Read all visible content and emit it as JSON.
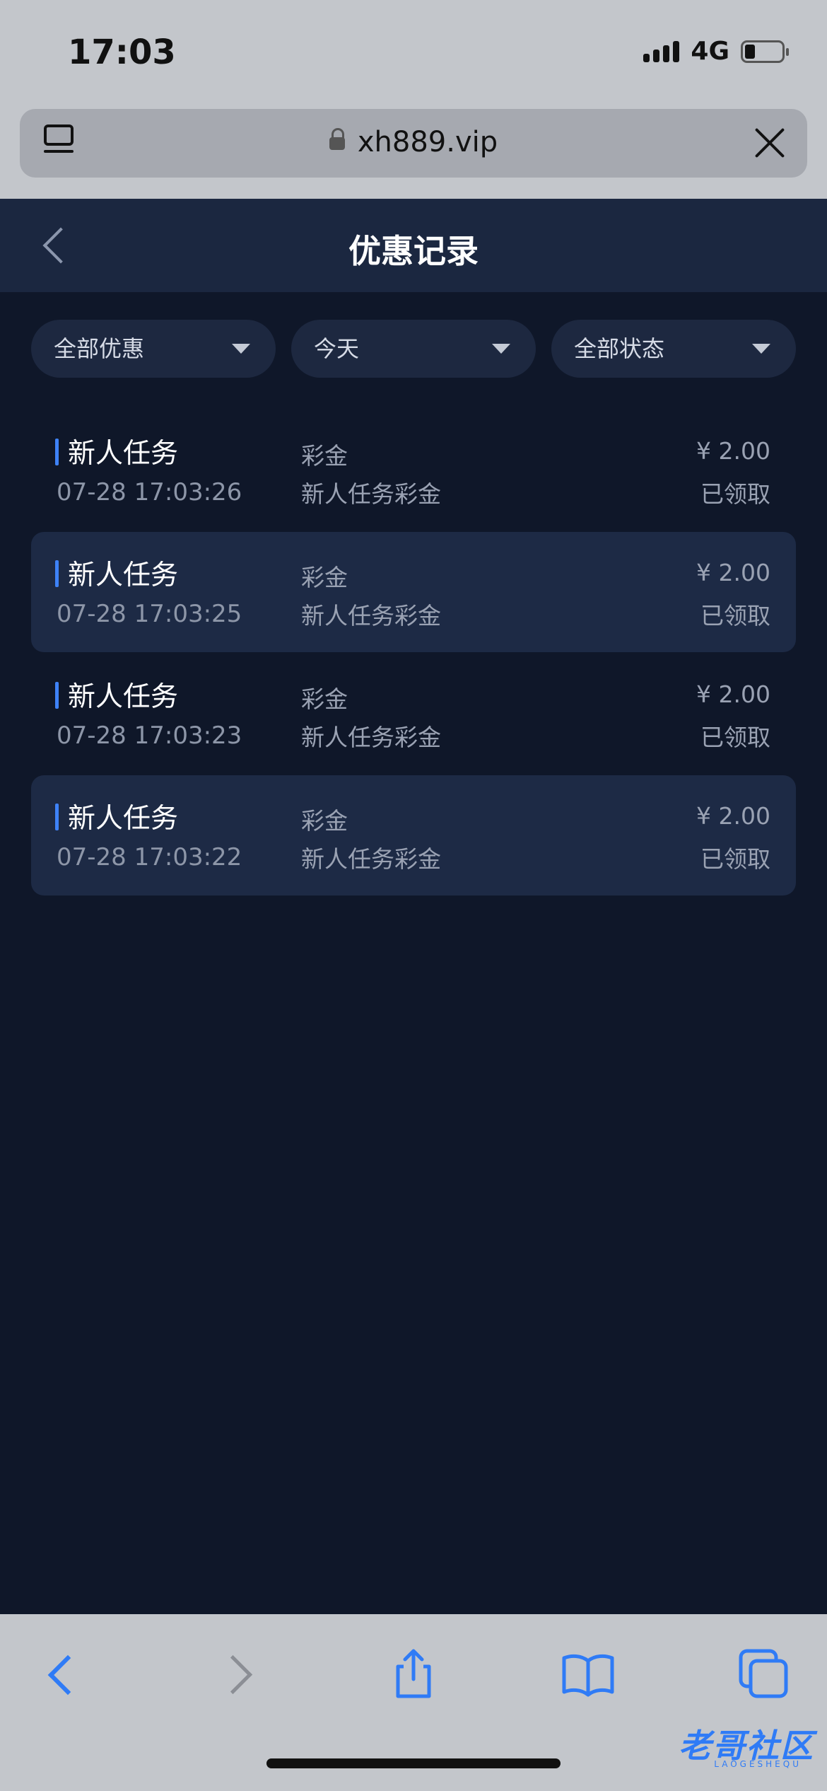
{
  "status_bar": {
    "time": "17:03",
    "network": "4G"
  },
  "browser": {
    "url": "xh889.vip"
  },
  "header": {
    "title": "优惠记录"
  },
  "filters": [
    {
      "label": "全部优惠"
    },
    {
      "label": "今天"
    },
    {
      "label": "全部状态"
    }
  ],
  "records": [
    {
      "title": "新人任务",
      "time": "07-28 17:03:26",
      "type": "彩金",
      "desc": "新人任务彩金",
      "amount": "¥ 2.00",
      "status": "已领取"
    },
    {
      "title": "新人任务",
      "time": "07-28 17:03:25",
      "type": "彩金",
      "desc": "新人任务彩金",
      "amount": "¥ 2.00",
      "status": "已领取"
    },
    {
      "title": "新人任务",
      "time": "07-28 17:03:23",
      "type": "彩金",
      "desc": "新人任务彩金",
      "amount": "¥ 2.00",
      "status": "已领取"
    },
    {
      "title": "新人任务",
      "time": "07-28 17:03:22",
      "type": "彩金",
      "desc": "新人任务彩金",
      "amount": "¥ 2.00",
      "status": "已领取"
    }
  ],
  "watermark": {
    "text": "老哥社区",
    "subtext": "LAOGESHEQU"
  },
  "colors": {
    "background": "#0f1729",
    "header": "#1b2740",
    "accent": "#3e82f7",
    "row_highlight": "#1d2a45"
  }
}
